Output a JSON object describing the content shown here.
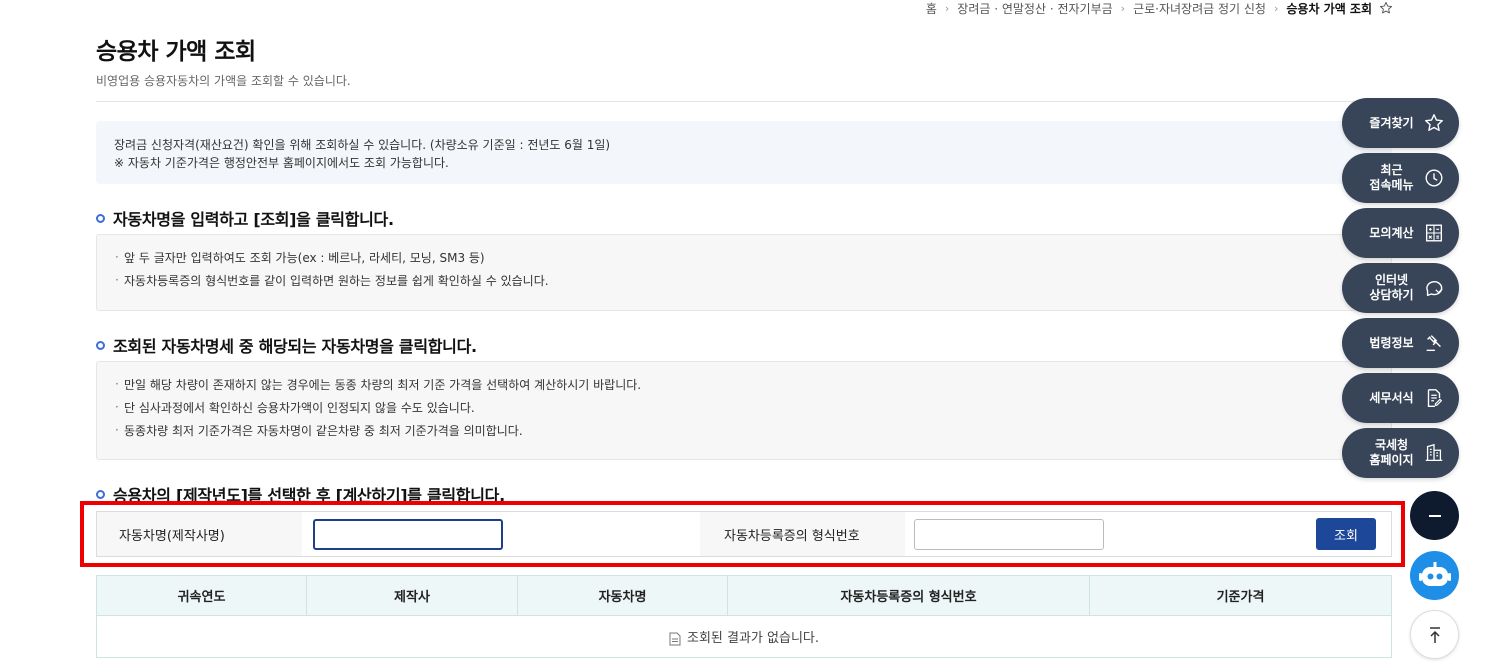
{
  "breadcrumb": {
    "items": [
      "홈",
      "장려금 · 연말정산 · 전자기부금",
      "근로·자녀장려금 정기 신청"
    ],
    "current": "승용차 가액 조회"
  },
  "header": {
    "title": "승용차 가액 조회",
    "subtitle": "비영업용 승용자동차의 가액을 조회할 수 있습니다."
  },
  "notice": {
    "line1": "장려금 신청자격(재산요건) 확인을 위해 조회하실 수 있습니다. (차량소유 기준일 : 전년도 6월 1일)",
    "line2": "※ 자동차 기준가격은 행정안전부 홈페이지에서도 조회 가능합니다."
  },
  "steps": [
    {
      "title": "자동차명을 입력하고 [조회]을 클릭합니다.",
      "items": [
        "앞 두 글자만 입력하여도 조회 가능(ex : 베르나, 라세티, 모닝, SM3 등)",
        "자동차등록증의 형식번호를 같이 입력하면 원하는 정보를 쉽게 확인하실 수 있습니다."
      ]
    },
    {
      "title": "조회된 자동차명세 중 해당되는 자동차명을 클릭합니다.",
      "items": [
        "만일 해당 차량이 존재하지 않는 경우에는 동종 차량의 최저 기준 가격을 선택하여 계산하시기 바랍니다.",
        "단 심사과정에서 확인하신 승용차가액이 인정되지 않을 수도 있습니다.",
        "동종차량 최저 기준가격은 자동차명이 같은차량 중  최저 기준가격을 의미합니다."
      ]
    },
    {
      "title": "승용차의 [제작년도]를 선택한 후 [계산하기]를 클릭합니다."
    }
  ],
  "search": {
    "car_name_label": "자동차명(제작사명)",
    "car_name_value": "",
    "type_no_label": "자동차등록증의 형식번호",
    "type_no_value": "",
    "button_label": "조회"
  },
  "table": {
    "headers": [
      "귀속연도",
      "제작사",
      "자동차명",
      "자동차등록증의 형식번호",
      "기준가격"
    ],
    "empty_message": "조회된 결과가 없습니다."
  },
  "side_menu": {
    "items": [
      {
        "label": "즐겨찾기",
        "icon": "star-icon"
      },
      {
        "label": "최근\n접속메뉴",
        "icon": "clock-icon"
      },
      {
        "label": "모의계산",
        "icon": "calculator-icon"
      },
      {
        "label": "인터넷\n상담하기",
        "icon": "chat-icon"
      },
      {
        "label": "법령정보",
        "icon": "gavel-icon"
      },
      {
        "label": "세무서식",
        "icon": "document-edit-icon"
      },
      {
        "label": "국세청\n홈페이지",
        "icon": "building-icon"
      }
    ]
  },
  "colors": {
    "accent": "#1d4799",
    "side_menu_bg": "#384558",
    "highlight": "#ee0000",
    "chatbot": "#1e8ee6"
  }
}
